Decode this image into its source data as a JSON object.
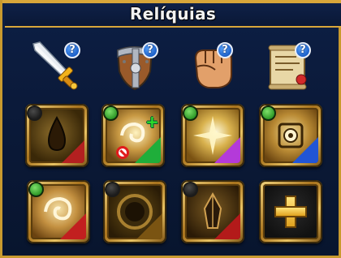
{
  "header": {
    "title": "Relíquias"
  },
  "categories": [
    {
      "name": "sword",
      "icon": "sword-icon",
      "help_icon": "?"
    },
    {
      "name": "shield",
      "icon": "shield-icon",
      "help_icon": "?"
    },
    {
      "name": "fist",
      "icon": "fist-icon",
      "help_icon": "?"
    },
    {
      "name": "scroll",
      "icon": "scroll-icon",
      "help_icon": "?"
    }
  ],
  "relic_slots": [
    {
      "icon": "dark-drop-relic-icon",
      "status": "inactive",
      "accent": "#b32020"
    },
    {
      "icon": "wind-swirl-relic-icon",
      "status": "active",
      "accent": "#1fae3a",
      "upgrade": "+"
    },
    {
      "icon": "light-star-relic-icon",
      "status": "active",
      "accent": "#b43ad9"
    },
    {
      "icon": "sun-sigil-relic-icon",
      "status": "active",
      "accent": "#2155d6"
    },
    {
      "icon": "swirl-relic-icon",
      "status": "active",
      "accent": "#c21f1f"
    },
    {
      "icon": "dark-orb-relic-icon",
      "status": "inactive",
      "accent": "#7a5412"
    },
    {
      "icon": "dark-crystal-relic-icon",
      "status": "inactive",
      "accent": "#b31a1a"
    }
  ],
  "add_slot": {
    "icon": "plus-icon",
    "label": "+"
  },
  "colors": {
    "frame_gold": "#d8a63a",
    "background": "#0b1a3a",
    "help_badge": "#1c5fc8"
  }
}
